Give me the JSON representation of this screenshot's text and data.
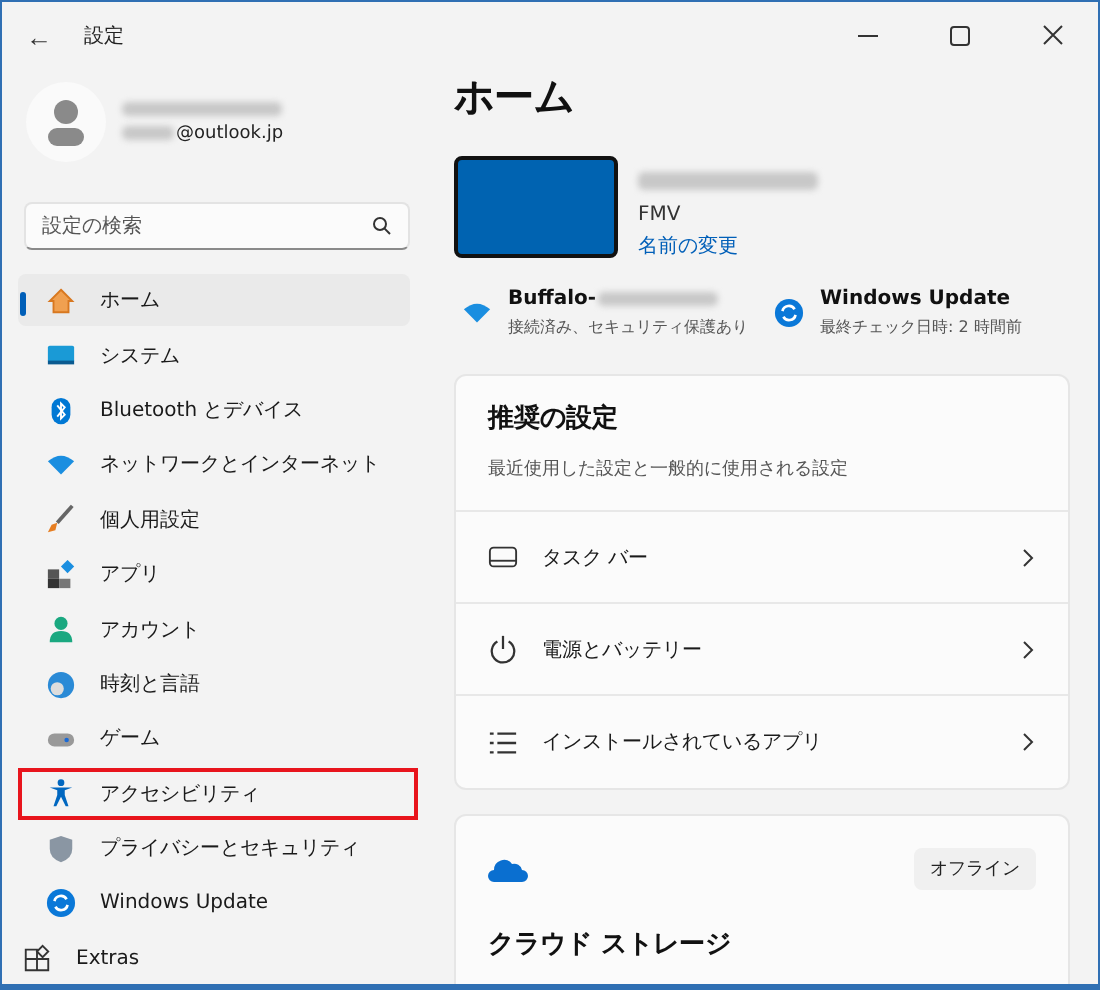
{
  "window": {
    "title": "設定",
    "back": "←"
  },
  "account": {
    "email_suffix": "@outlook.jp"
  },
  "search": {
    "placeholder": "設定の検索"
  },
  "nav": [
    {
      "label": "ホーム",
      "kind": "home",
      "selected": true,
      "highlighted": false
    },
    {
      "label": "システム",
      "kind": "system",
      "selected": false,
      "highlighted": false
    },
    {
      "label": "Bluetooth とデバイス",
      "kind": "bluetooth",
      "selected": false,
      "highlighted": false
    },
    {
      "label": "ネットワークとインターネット",
      "kind": "wifi",
      "selected": false,
      "highlighted": false
    },
    {
      "label": "個人用設定",
      "kind": "brush",
      "selected": false,
      "highlighted": false
    },
    {
      "label": "アプリ",
      "kind": "apps",
      "selected": false,
      "highlighted": false
    },
    {
      "label": "アカウント",
      "kind": "account",
      "selected": false,
      "highlighted": false
    },
    {
      "label": "時刻と言語",
      "kind": "globe",
      "selected": false,
      "highlighted": false
    },
    {
      "label": "ゲーム",
      "kind": "game",
      "selected": false,
      "highlighted": false
    },
    {
      "label": "アクセシビリティ",
      "kind": "accessibility",
      "selected": false,
      "highlighted": true
    },
    {
      "label": "プライバシーとセキュリティ",
      "kind": "shield",
      "selected": false,
      "highlighted": false
    },
    {
      "label": "Windows Update",
      "kind": "update",
      "selected": false,
      "highlighted": false
    },
    {
      "label": "Extras",
      "kind": "extras",
      "selected": false,
      "highlighted": false
    }
  ],
  "page": {
    "title": "ホーム",
    "device": {
      "model": "FMV",
      "rename_link": "名前の変更"
    },
    "status": [
      {
        "kind": "wifi",
        "title": "Buffalo-",
        "subtitle": "接続済み、セキュリティ保護あり"
      },
      {
        "kind": "update",
        "title": "Windows Update",
        "subtitle": "最終チェック日時: 2 時間前"
      }
    ],
    "recommended": {
      "title": "推奨の設定",
      "subtitle": "最近使用した設定と一般的に使用される設定",
      "rows": [
        {
          "kind": "taskbar",
          "label": "タスク バー"
        },
        {
          "kind": "power",
          "label": "電源とバッテリー"
        },
        {
          "kind": "list",
          "label": "インストールされているアプリ"
        }
      ]
    },
    "cloud": {
      "badge": "オフライン",
      "title": "クラウド ストレージ"
    }
  }
}
